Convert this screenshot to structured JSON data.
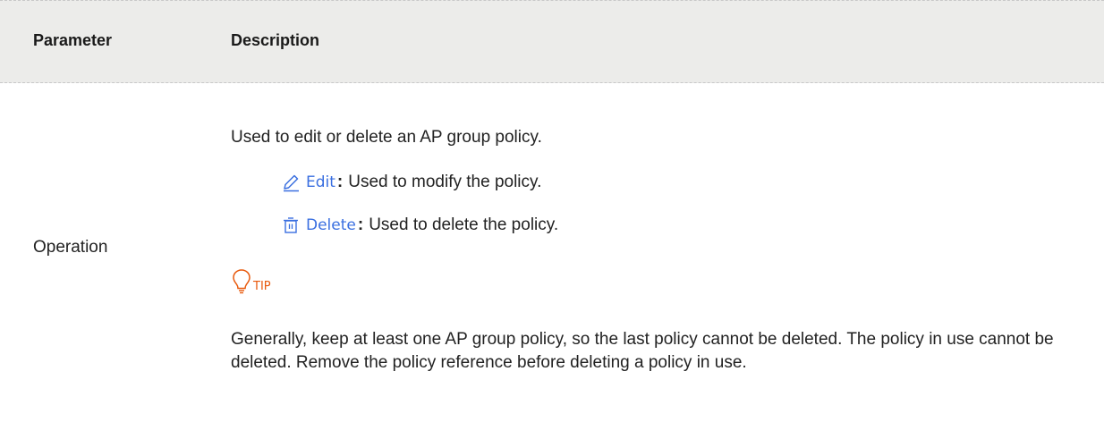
{
  "table": {
    "headers": {
      "parameter": "Parameter",
      "description": "Description"
    },
    "row": {
      "parameter": "Operation",
      "intro": "Used to edit or delete an AP group policy.",
      "operations": [
        {
          "icon": "edit-icon",
          "label": "Edit",
          "colon": ":",
          "text": "Used to modify the policy."
        },
        {
          "icon": "delete-icon",
          "label": "Delete",
          "colon": ":",
          "text": "Used to delete the policy."
        }
      ],
      "tip": {
        "icon": "lightbulb-icon",
        "label": "TIP",
        "text": "Generally, keep at least one AP group policy, so the last policy cannot be deleted. The policy in use cannot be deleted. Remove the policy reference before deleting a policy in use."
      }
    }
  },
  "colors": {
    "header_bg": "#ececea",
    "link": "#3a6fe0",
    "tip": "#e8590c"
  }
}
